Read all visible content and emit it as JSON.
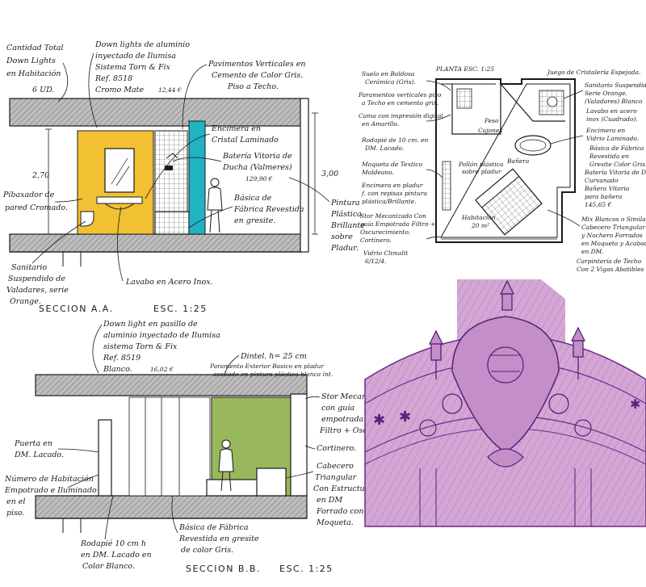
{
  "section_aa": {
    "title": "SECCION A.A.",
    "scale": "ESC. 1:25",
    "dim_left": "2,70",
    "dim_right": "3,00",
    "notes": {
      "downlights_total_1": "Cantidad Total",
      "downlights_total_2": "Down Lights",
      "downlights_total_3": "en Habitación",
      "downlights_total_4": "6 UD.",
      "downlight_1": "Down lights de aluminio",
      "downlight_2": "inyectado de Ilumisa",
      "downlight_3": "Sistema Torn & Fix",
      "downlight_4": "Ref. 8518",
      "downlight_5": "Cromo Mate",
      "downlight_price": "12,44 €",
      "pavimentos_1": "Pavimentos Verticales en",
      "pavimentos_2": "Cemento de Color Gris.",
      "pavimentos_3": "Piso a Techo.",
      "encimera_1": "Encimera en",
      "encimera_2": "Cristal Laminado",
      "bateria_1": "Batería Vitoria de",
      "bateria_2": "Ducha (Valmeres)",
      "bateria_price": "129,90 €",
      "basica_1": "Básica de",
      "basica_2": "Fábrica Revestida",
      "basica_3": "en gresite.",
      "pintura_1": "Pintura",
      "pintura_2": "Plástica",
      "pintura_3": "Brillante",
      "pintura_4": "sobre",
      "pintura_5": "Pladur.",
      "pibaxador_1": "Pibaxador de",
      "pibaxador_2": "pared Cromado.",
      "sanitario_1": "Sanitario",
      "sanitario_2": "Suspendido de",
      "sanitario_3": "Valadares, serie",
      "sanitario_4": "Orange.",
      "lavabo": "Lavabo en Acero Inox."
    }
  },
  "planta": {
    "title": "PLANTA ESC. 1:25",
    "left_notes": [
      "Suelo en Baldosa",
      "Cerámica (Gris).",
      "Paramentos verticales piso",
      "a Techo en cemento gris.",
      "Cama con impresión digital",
      "en Amarillo.",
      "Rodapié de 10 cm. en",
      "DM. Lacado.",
      "Moqueta de Textico",
      "Moldeano.",
      "Encimera en pladur",
      "f. con repisas pintura",
      "plástica/Brillante.",
      "Stor Mecanizado Con",
      "guía Empotrada Filtro +",
      "Oscurecimiento.",
      "Cortinero.",
      "Vidrio Climalit",
      "6/12/4."
    ],
    "right_notes": [
      "Juego de Cristalería Espejada.",
      "Sanitario Suspendido",
      "Serie Orange.",
      "(Valadares) Blanco",
      "Lavabo en acero",
      "inox (Cuadrado).",
      "Encimera en",
      "Vidrio Laminado.",
      "Básica de Fábrica",
      "Revestida en",
      "Gresite Color Gris.",
      "Batería Vitoria de Ducha",
      "Curvanado",
      "Bañera Vitoria",
      "para bañera",
      "145,65 €",
      "Mix Blancos o Similar.",
      "Cabecero Triangular",
      "y Nochero Forrados",
      "en Moqueta y Acabados",
      "en DM.",
      "Carpintería de Techo",
      "Con 2 Vigas Abatibles"
    ],
    "inner_labels": [
      "Peso",
      "Cajones",
      "Bañera",
      "Habitación",
      "20 m²",
      "Pollón plástica",
      "sobre pladur"
    ]
  },
  "section_bb": {
    "title": "SECCION B.B.",
    "scale": "ESC. 1:25",
    "notes": {
      "downlight_1": "Down light en pasillo de",
      "downlight_2": "aluminio inyectado de Ilumisa",
      "downlight_3": "sistema Torn & Fix",
      "downlight_4": "Ref. 8519",
      "downlight_5": "Blanco.",
      "downlight_price": "16,02 €",
      "dintel": "Dintel. h= 25 cm",
      "paramento_1": "Paramento Exterior Basico en pladur",
      "paramento_2": "acabado en pintura plástica blanca int.",
      "stor_1": "Stor Mecanizado",
      "stor_2": "con guía",
      "stor_3": "empotrada",
      "stor_4": "Filtro + Oscuridad.",
      "cortinero": "Cortinero.",
      "cabecero_1": "Cabecero",
      "cabecero_2": "Triangular",
      "cabecero_3": "Con Estructura",
      "cabecero_4": "en DM",
      "cabecero_5": "Forrado con",
      "cabecero_6": "Moqueta.",
      "puerta_1": "Puerta en",
      "puerta_2": "DM. Lacado.",
      "numero_1": "Número de Habitación",
      "numero_2": "Empotrado e Iluminado",
      "numero_3": "en el",
      "numero_4": "piso.",
      "rodapie_1": "Rodapié 10 cm h",
      "rodapie_2": "en DM. Lacado en",
      "rodapie_3": "Color Blanco.",
      "basica_1": "Básica de Fábrica",
      "basica_2": "Revestida en gresite",
      "basica_3": "de color Gris."
    }
  },
  "colors": {
    "yellow_panel": "#f2c133",
    "cyan_panel": "#22b3c2",
    "green_wall": "#99b75b",
    "hatch_gray": "#9a9a9a",
    "sketch_pink": "#cf9fcf",
    "sketch_purple": "#6a2a8a"
  }
}
